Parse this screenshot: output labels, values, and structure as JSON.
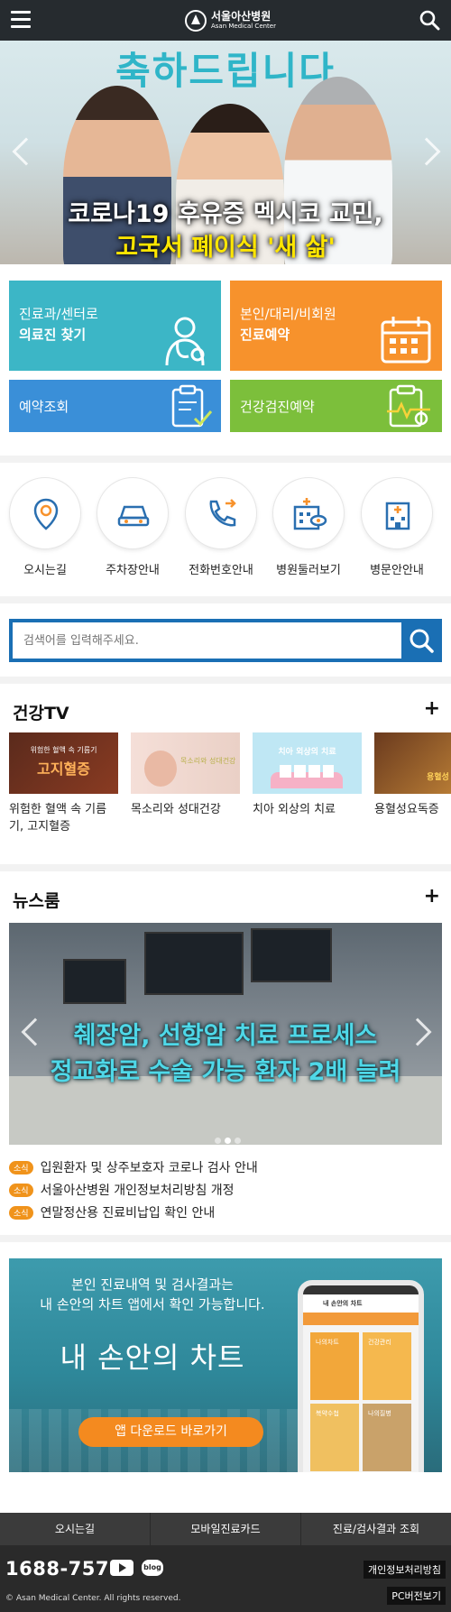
{
  "header": {
    "logo_kr": "서울아산병원",
    "logo_en": "Asan Medical Center"
  },
  "hero": {
    "title": "축하드립니다",
    "caption_line1": "코로나19 후유증 멕시코 교민,",
    "caption_line2": "고국서 폐이식 '새 삶'"
  },
  "quick": {
    "tile1_line1": "진료과/센터로",
    "tile1_line2": "의료진 찾기",
    "tile2_line1": "본인/대리/비회원",
    "tile2_line2": "진료예약",
    "tile3": "예약조회",
    "tile4": "건강검진예약",
    "colors": {
      "teal": "#3cb6c6",
      "orange": "#f7922c",
      "blue": "#3a8fd8",
      "green": "#7cbf3b"
    }
  },
  "icons": [
    {
      "label": "오시는길",
      "icon": "location-pin-icon"
    },
    {
      "label": "주차장안내",
      "icon": "car-icon"
    },
    {
      "label": "전화번호안내",
      "icon": "phone-icon"
    },
    {
      "label": "병원둘러보기",
      "icon": "hospital-tour-icon"
    },
    {
      "label": "병문안안내",
      "icon": "hospital-building-icon"
    }
  ],
  "search": {
    "placeholder": "검색어를 입력해주세요."
  },
  "tv": {
    "title": "건강TV",
    "plus": "+",
    "items": [
      {
        "caption": "위험한 혈액 속 기름기, 고지혈증",
        "thumb_small": "위험한 혈액 속 기름기",
        "thumb_big": "고지혈증"
      },
      {
        "caption": "목소리와 성대건강",
        "thumb_small": "목소리와 성대건강"
      },
      {
        "caption": "치아 외상의 치료",
        "thumb_small": "치아 외상의 치료"
      },
      {
        "caption": "용혈성요독증",
        "thumb_small": "용혈성"
      }
    ]
  },
  "news": {
    "title": "뉴스룸",
    "plus": "+",
    "headline1": "췌장암, 선항암 치료 프로세스",
    "headline2": "정교화로 수술 가능 환자 2배 늘려",
    "badge": "소식",
    "items": [
      "입원환자 및 상주보호자 코로나 검사 안내",
      "서울아산병원 개인정보처리방침 개정",
      "연말정산용 진료비납입 확인 안내"
    ]
  },
  "banner": {
    "line1": "본인 진료내역 및 검사결과는",
    "line2": "내 손안의 차트 앱에서 확인 가능합니다.",
    "big": "내 손안의 차트",
    "button": "앱 다운로드 바로가기",
    "phone_title": "내 손안의 차트",
    "phone_cells": [
      "나의차트",
      "건강관리",
      "복약수첩",
      "나의질병"
    ]
  },
  "footer": {
    "nav": [
      "오시는길",
      "모바일진료카드",
      "진료/검사결과 조회"
    ],
    "tel": "1688-7575",
    "blog": "blog",
    "privacy": "개인정보처리방침",
    "pc": "PC버전보기",
    "copyright": "© Asan Medical Center. All rights reserved."
  }
}
